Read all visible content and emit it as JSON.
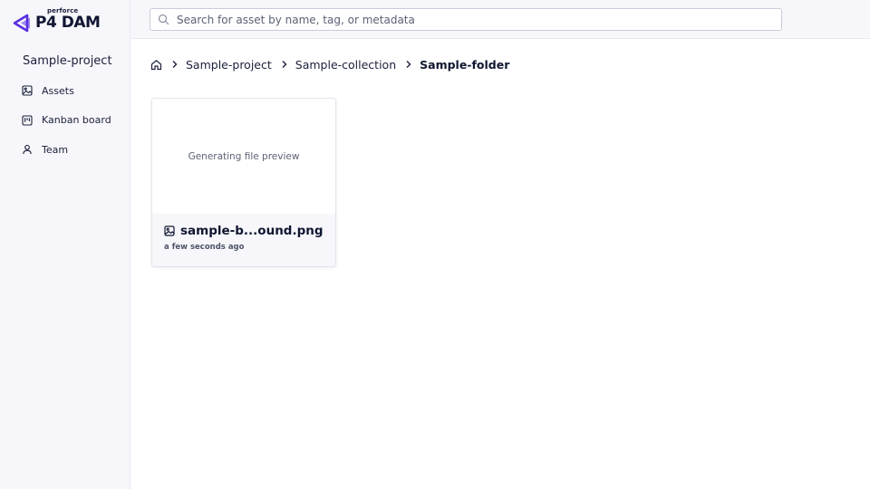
{
  "brand": {
    "small": "perforce",
    "big": "P4 DAM",
    "accent": "#5a2fe0"
  },
  "sidebar": {
    "project": "Sample-project",
    "items": [
      {
        "label": "Assets",
        "icon": "image-icon"
      },
      {
        "label": "Kanban board",
        "icon": "kanban-icon"
      },
      {
        "label": "Team",
        "icon": "user-icon"
      }
    ]
  },
  "search": {
    "placeholder": "Search for asset by name, tag, or metadata",
    "value": ""
  },
  "breadcrumb": {
    "items": [
      "Sample-project",
      "Sample-collection"
    ],
    "current": "Sample-folder"
  },
  "assets": [
    {
      "preview_text": "Generating file preview",
      "name": "sample-b...ound.png",
      "time": "a few seconds ago",
      "icon": "image-icon"
    }
  ]
}
